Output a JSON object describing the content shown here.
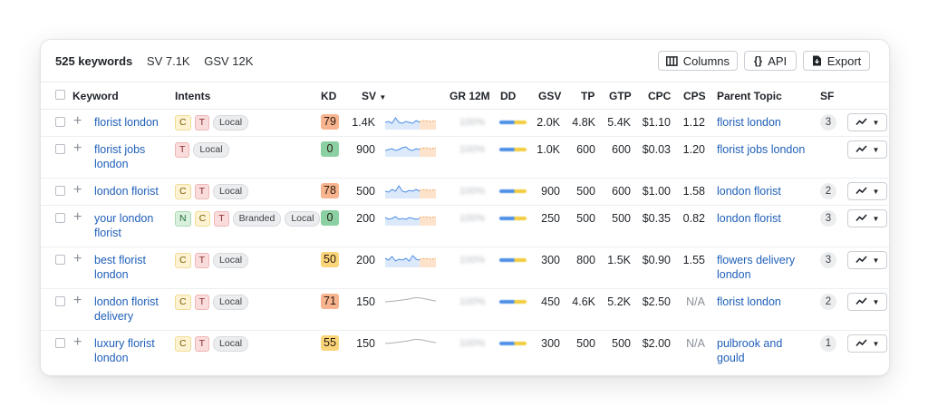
{
  "summary": {
    "count": "525 keywords",
    "sv": "SV 7.1K",
    "gsv": "GSV 12K"
  },
  "toolbar": {
    "columns_label": "Columns",
    "api_label": "API",
    "api_icon": "{}",
    "export_label": "Export"
  },
  "columns": {
    "keyword": "Keyword",
    "intents": "Intents",
    "kd": "KD",
    "sv": "SV",
    "gr12m": "GR 12M",
    "dd": "DD",
    "gsv": "GSV",
    "tp": "TP",
    "gtp": "GTP",
    "cpc": "CPC",
    "cps": "CPS",
    "parent_topic": "Parent Topic",
    "sf": "SF"
  },
  "colors": {
    "link": "#1f5fb8",
    "kd_orange": "#f7b48e",
    "kd_green": "#8bd0a2",
    "kd_yellow": "#fad57a",
    "spark_blue": "#4d8ee6",
    "spark_orange": "#f0a35a"
  },
  "rows": [
    {
      "keyword": "florist london",
      "intents": [
        "C",
        "T",
        "Local"
      ],
      "kd": "79",
      "kd_color": "#f7b48e",
      "sv": "1.4K",
      "gr12m": "100%",
      "gsv": "2.0K",
      "tp": "4.8K",
      "gtp": "5.4K",
      "cpc": "$1.10",
      "cps": "1.12",
      "parent_topic": "florist london",
      "sf": "3",
      "spark": "detailed"
    },
    {
      "keyword": "florist jobs london",
      "intents": [
        "T",
        "Local"
      ],
      "kd": "0",
      "kd_color": "#8bd0a2",
      "sv": "900",
      "gr12m": "100%",
      "gsv": "1.0K",
      "tp": "600",
      "gtp": "600",
      "cpc": "$0.03",
      "cps": "1.20",
      "parent_topic": "florist jobs london",
      "sf": "",
      "spark": "detailed"
    },
    {
      "keyword": "london florist",
      "intents": [
        "C",
        "T",
        "Local"
      ],
      "kd": "78",
      "kd_color": "#f7b48e",
      "sv": "500",
      "gr12m": "100%",
      "gsv": "900",
      "tp": "500",
      "gtp": "600",
      "cpc": "$1.00",
      "cps": "1.58",
      "parent_topic": "london florist",
      "sf": "2",
      "spark": "detailed"
    },
    {
      "keyword": "your london florist",
      "intents": [
        "N",
        "C",
        "T",
        "Branded",
        "Local"
      ],
      "kd": "0",
      "kd_color": "#8bd0a2",
      "sv": "200",
      "gr12m": "100%",
      "gsv": "250",
      "tp": "500",
      "gtp": "500",
      "cpc": "$0.35",
      "cps": "0.82",
      "parent_topic": "london florist",
      "sf": "3",
      "spark": "detailed"
    },
    {
      "keyword": "best florist london",
      "intents": [
        "C",
        "T",
        "Local"
      ],
      "kd": "50",
      "kd_color": "#fad57a",
      "sv": "200",
      "gr12m": "100%",
      "gsv": "300",
      "tp": "800",
      "gtp": "1.5K",
      "cpc": "$0.90",
      "cps": "1.55",
      "parent_topic": "flowers delivery london",
      "sf": "3",
      "spark": "detailed"
    },
    {
      "keyword": "london florist delivery",
      "intents": [
        "C",
        "T",
        "Local"
      ],
      "kd": "71",
      "kd_color": "#f7b48e",
      "sv": "150",
      "gr12m": "100%",
      "gsv": "450",
      "tp": "4.6K",
      "gtp": "5.2K",
      "cpc": "$2.50",
      "cps": "N/A",
      "parent_topic": "florist london",
      "sf": "2",
      "spark": "smooth"
    },
    {
      "keyword": "luxury florist london",
      "intents": [
        "C",
        "T",
        "Local"
      ],
      "kd": "55",
      "kd_color": "#fad57a",
      "sv": "150",
      "gr12m": "100%",
      "gsv": "300",
      "tp": "500",
      "gtp": "500",
      "cpc": "$2.00",
      "cps": "N/A",
      "parent_topic": "pulbrook and gould",
      "sf": "1",
      "spark": "smooth"
    }
  ]
}
